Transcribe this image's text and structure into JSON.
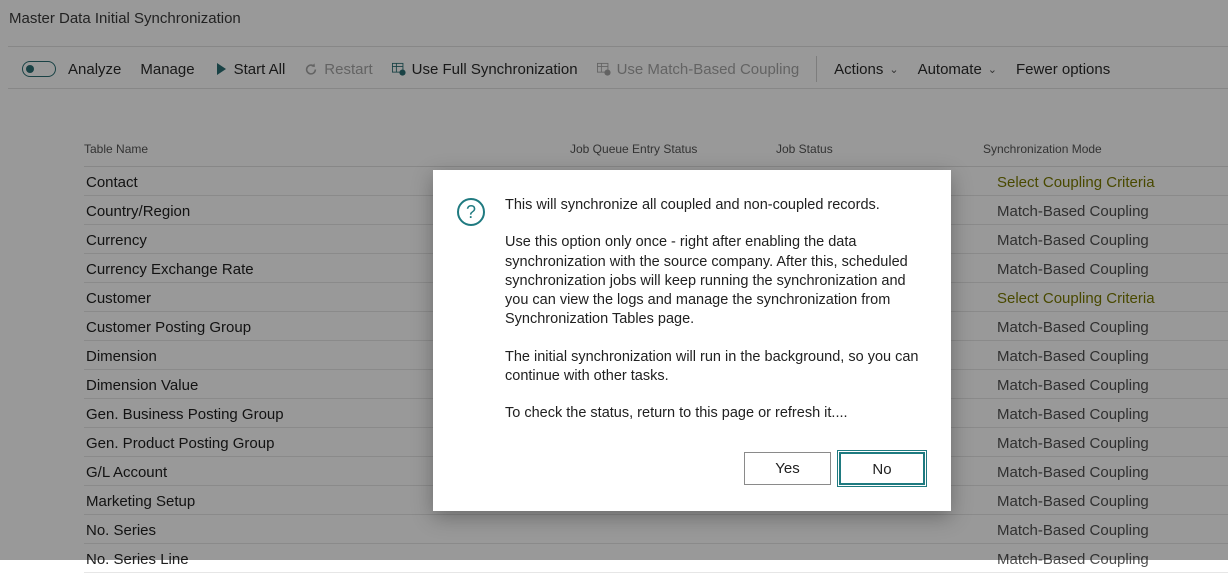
{
  "page": {
    "title": "Master Data Initial Synchronization"
  },
  "toolbar": {
    "analyze_label": "Analyze",
    "manage_label": "Manage",
    "start_all_label": "Start All",
    "restart_label": "Restart",
    "use_full_sync_label": "Use Full Synchronization",
    "use_match_based_label": "Use Match-Based Coupling",
    "actions_label": "Actions",
    "automate_label": "Automate",
    "fewer_options_label": "Fewer options"
  },
  "grid": {
    "columns": {
      "table_name": "Table Name",
      "job_queue_entry_status": "Job Queue Entry Status",
      "job_status": "Job Status",
      "synchronization_mode": "Synchronization Mode"
    },
    "rows": [
      {
        "name": "Contact",
        "mode": "Select Coupling Criteria"
      },
      {
        "name": "Country/Region",
        "mode": "Match-Based Coupling"
      },
      {
        "name": "Currency",
        "mode": "Match-Based Coupling"
      },
      {
        "name": "Currency Exchange Rate",
        "mode": "Match-Based Coupling"
      },
      {
        "name": "Customer",
        "mode": "Select Coupling Criteria"
      },
      {
        "name": "Customer Posting Group",
        "mode": "Match-Based Coupling"
      },
      {
        "name": "Dimension",
        "mode": "Match-Based Coupling"
      },
      {
        "name": "Dimension Value",
        "mode": "Match-Based Coupling"
      },
      {
        "name": "Gen. Business Posting Group",
        "mode": "Match-Based Coupling"
      },
      {
        "name": "Gen. Product Posting Group",
        "mode": "Match-Based Coupling"
      },
      {
        "name": "G/L Account",
        "mode": "Match-Based Coupling"
      },
      {
        "name": "Marketing Setup",
        "mode": "Match-Based Coupling"
      },
      {
        "name": "No. Series",
        "mode": "Match-Based Coupling"
      },
      {
        "name": "No. Series Line",
        "mode": "Match-Based Coupling"
      }
    ]
  },
  "dialog": {
    "icon": "question-icon",
    "paragraph1": "This will synchronize all coupled and non-coupled records.",
    "paragraph2": "Use this option only once - right after enabling the data synchronization with the source company. After this, scheduled synchronization jobs will keep running the synchronization and you can view the logs and manage the synchronization from Synchronization Tables page.",
    "paragraph3": "The initial synchronization will run in the background, so you can continue with other tasks.",
    "paragraph4": "To check the status, return to this page or refresh it....",
    "yes_label": "Yes",
    "no_label": "No"
  },
  "colors": {
    "accent": "#1f7a80",
    "select_criteria": "#7a7a00",
    "overlay": "rgba(0,0,0,0.40)"
  }
}
